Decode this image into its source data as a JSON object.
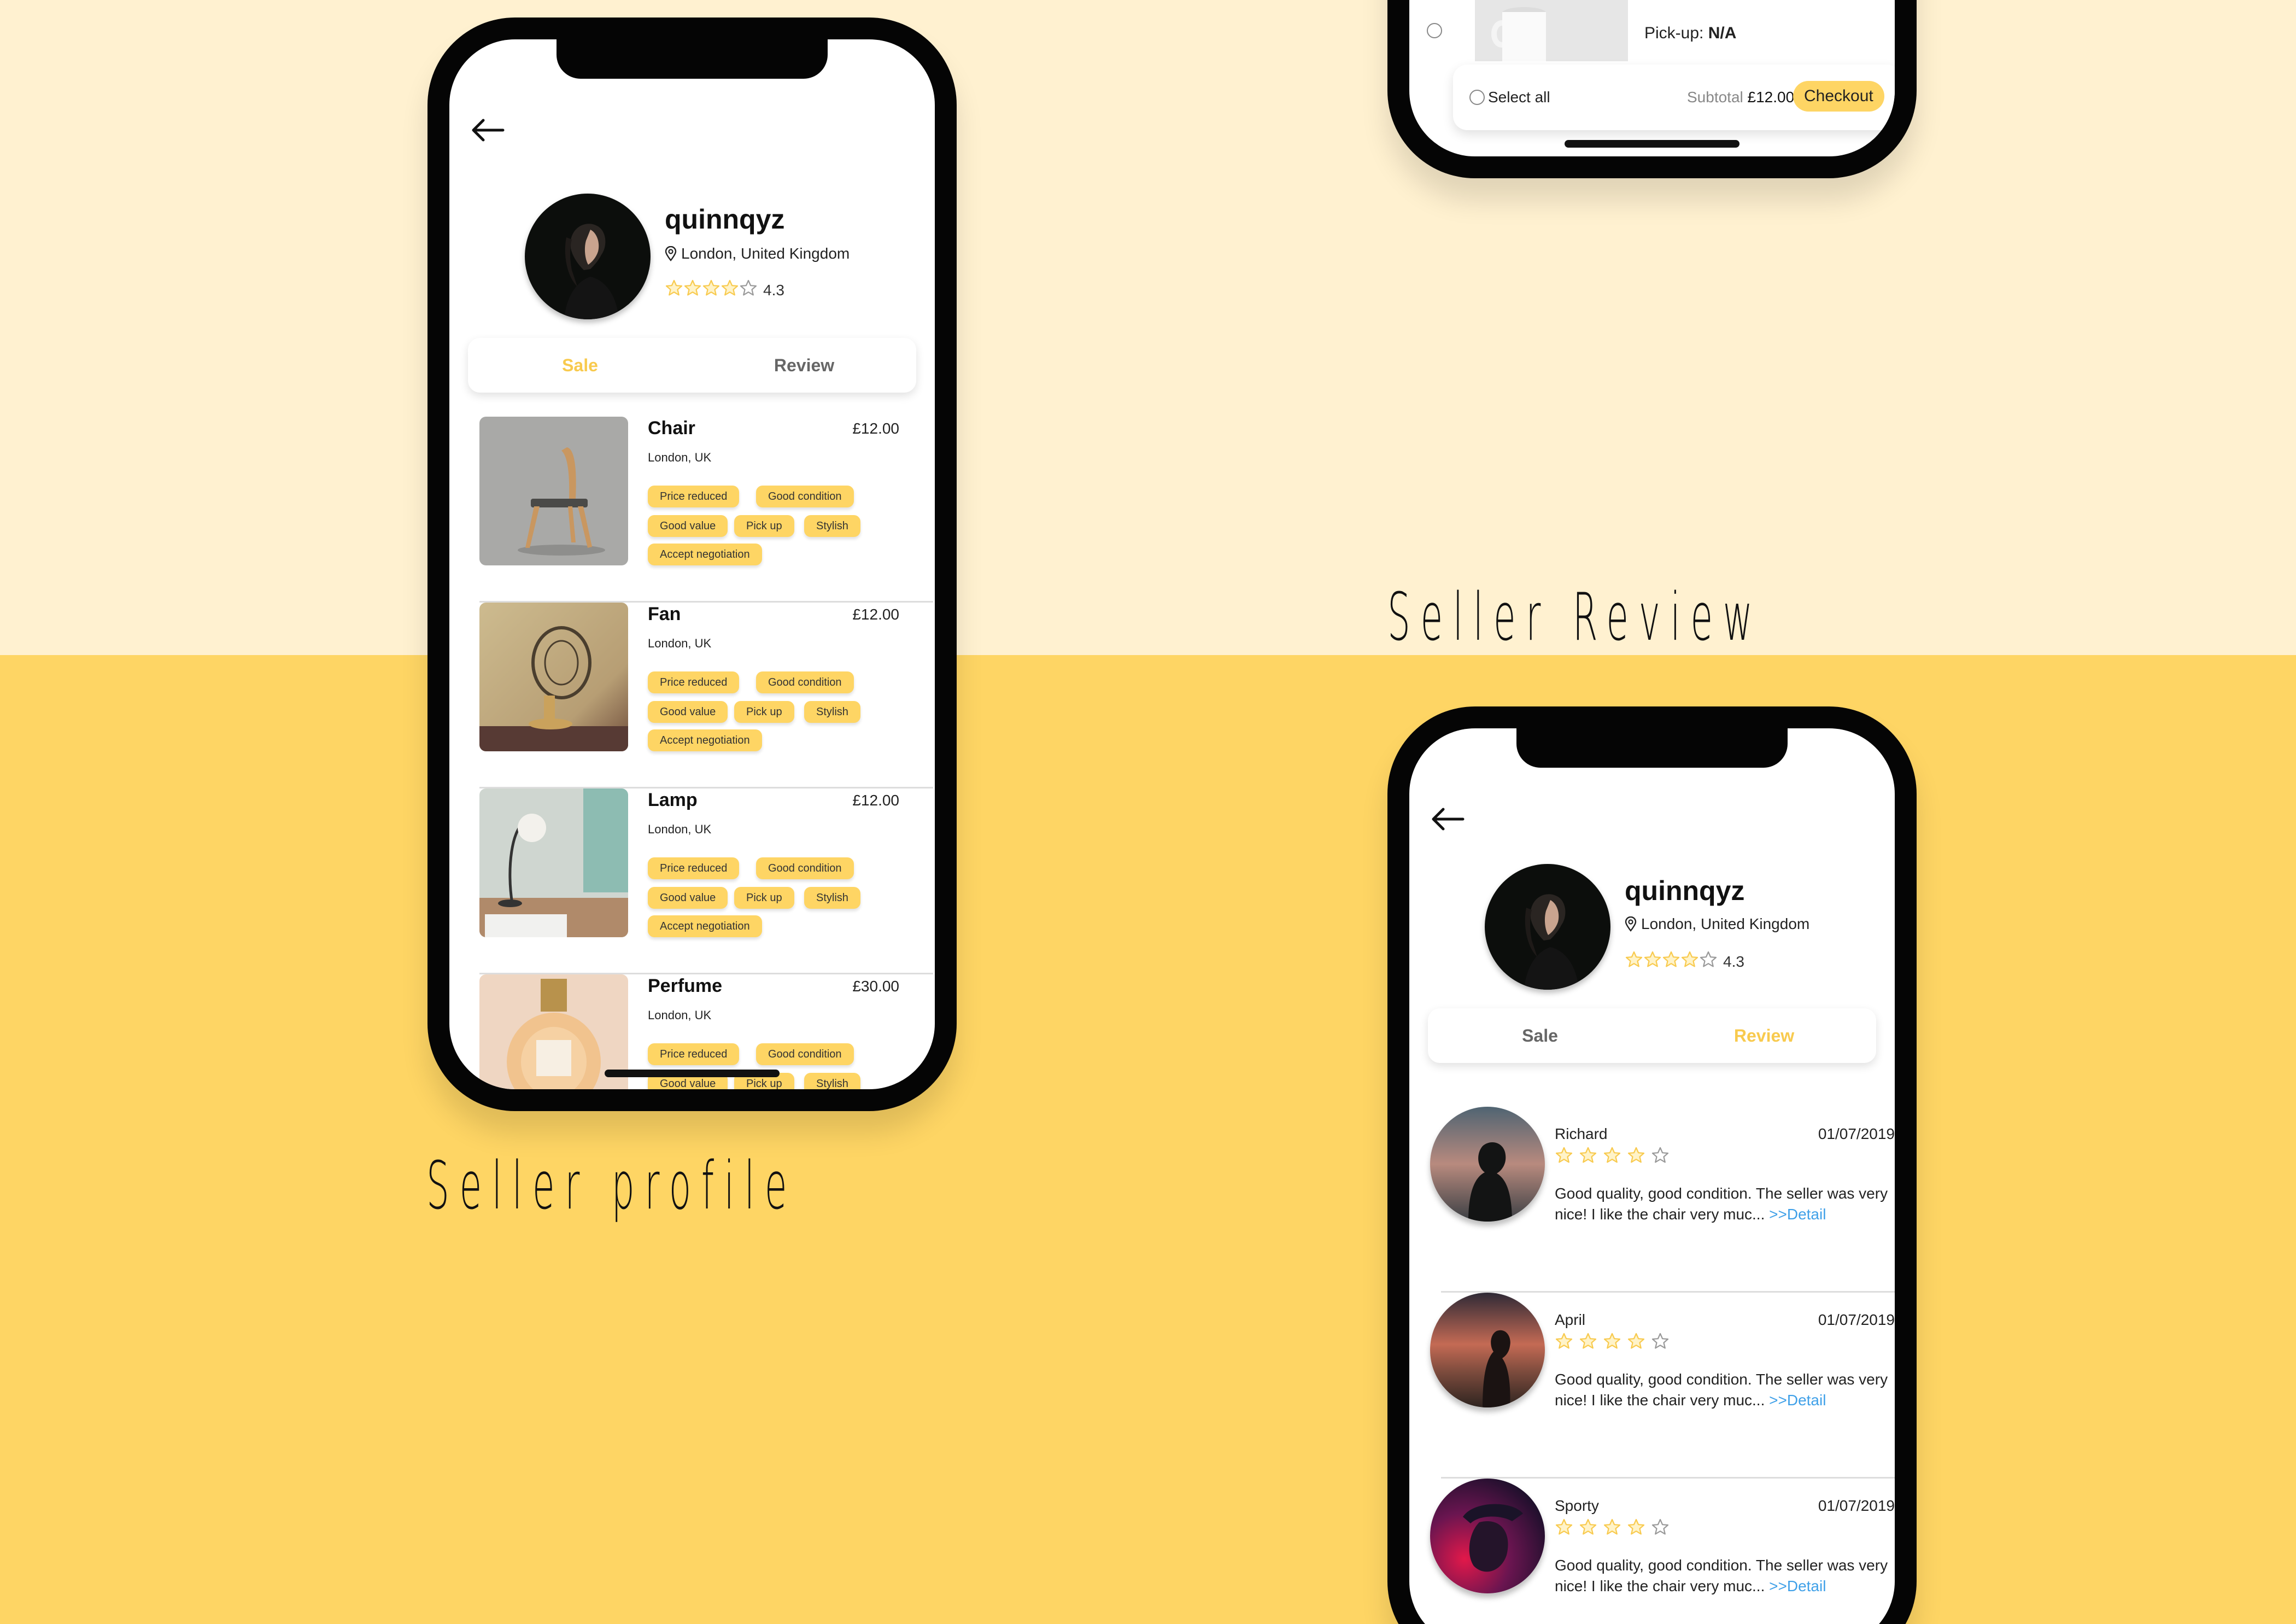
{
  "colors": {
    "accent": "#FED564",
    "accent_text": "#F8CA4E",
    "link": "#3FA0E8",
    "bg_top": "#FFF1D0",
    "bg_bottom": "#FED564"
  },
  "captions": {
    "seller_profile": "Seller profile",
    "seller_review": "Seller Review"
  },
  "profile": {
    "username": "quinnqyz",
    "location": "London, United Kingdom",
    "rating": "4.3",
    "stars_filled": 4,
    "stars_total": 5
  },
  "tabs": {
    "sale": "Sale",
    "review": "Review"
  },
  "sale_items": [
    {
      "title": "Chair",
      "price": "£12.00",
      "location": "London, UK",
      "icon": "chair-photo"
    },
    {
      "title": "Fan",
      "price": "£12.00",
      "location": "London, UK",
      "icon": "fan-photo"
    },
    {
      "title": "Lamp",
      "price": "£12.00",
      "location": "London, UK",
      "icon": "lamp-photo"
    },
    {
      "title": "Perfume",
      "price": "£30.00",
      "location": "London, UK",
      "icon": "perfume-photo"
    }
  ],
  "tags": [
    "Price reduced",
    "Good condition",
    "Good value",
    "Pick up",
    "Stylish",
    "Accept negotiation"
  ],
  "cart": {
    "seller_link": "quinnqyz",
    "pickup_label": "Pick-up: ",
    "pickup_value": "N/A",
    "select_all": "Select all",
    "subtotal_label": "Subtotal ",
    "subtotal_value": "£12.00",
    "checkout": "Checkout"
  },
  "reviews": [
    {
      "name": "Richard",
      "date": "01/07/2019",
      "stars_filled": 4,
      "text": "Good quality, good condition. The seller was very nice! I like the chair very muc... ",
      "detail": ">>Detail"
    },
    {
      "name": "April",
      "date": "01/07/2019",
      "stars_filled": 4,
      "text": "Good quality, good condition. The seller was very nice! I like the chair very muc... ",
      "detail": ">>Detail"
    },
    {
      "name": "Sporty",
      "date": "01/07/2019",
      "stars_filled": 4,
      "text": "Good quality, good condition. The seller was very nice! I like the chair very muc... ",
      "detail": ">>Detail"
    }
  ]
}
